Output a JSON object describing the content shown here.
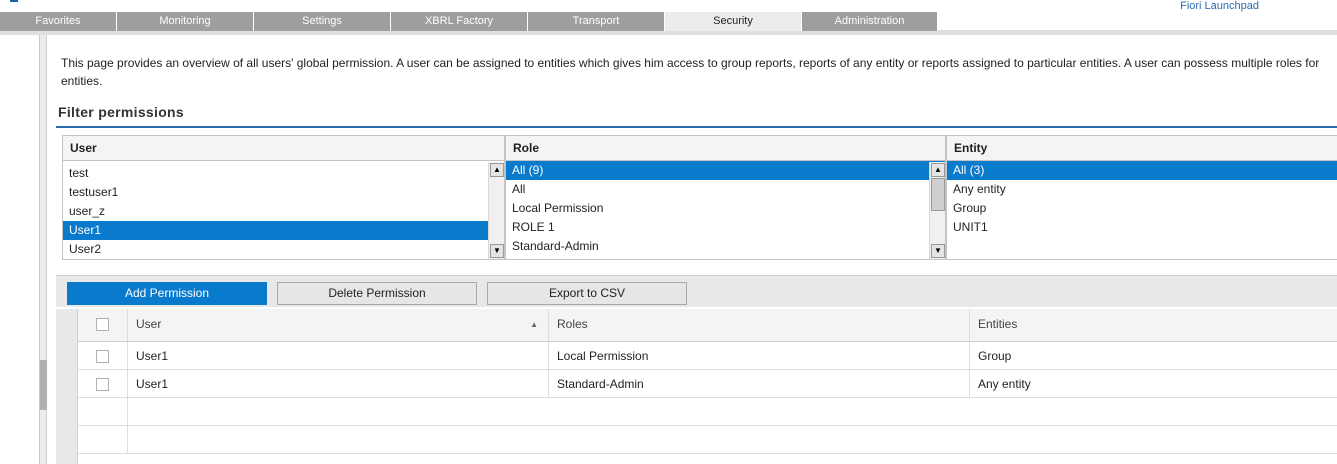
{
  "app": {
    "launchpad_link": "Fiori Launchpad"
  },
  "tabs": [
    {
      "label": "Favorites"
    },
    {
      "label": "Monitoring"
    },
    {
      "label": "Settings"
    },
    {
      "label": "XBRL Factory"
    },
    {
      "label": "Transport"
    },
    {
      "label": "Security",
      "active": true
    },
    {
      "label": "Administration"
    }
  ],
  "description": "This page provides an overview of all users' global permission. A user can be assigned to entities which gives him access to group reports, reports of any entity or reports assigned to particular entities. A user can possess multiple roles for entities.",
  "filter": {
    "title": "Filter permissions",
    "user": {
      "header": "User",
      "items": [
        "test",
        "testuser1",
        "user_z",
        "User1",
        "User2"
      ],
      "selected": "User1"
    },
    "role": {
      "header": "Role",
      "items": [
        "All (9)",
        "All",
        "Local Permission",
        "ROLE 1",
        "Standard-Admin"
      ],
      "selected": "All (9)"
    },
    "entity": {
      "header": "Entity",
      "items": [
        "All (3)",
        "Any entity",
        "Group",
        "UNIT1"
      ],
      "selected": "All (3)"
    }
  },
  "toolbar": {
    "add_label": "Add Permission",
    "delete_label": "Delete Permission",
    "export_label": "Export to CSV"
  },
  "table": {
    "columns": {
      "user": "User",
      "roles": "Roles",
      "entities": "Entities"
    },
    "sort_indicator": "▲",
    "rows": [
      {
        "user": "User1",
        "roles": "Local Permission",
        "entities": "Group"
      },
      {
        "user": "User1",
        "roles": "Standard-Admin",
        "entities": "Any entity"
      }
    ]
  }
}
